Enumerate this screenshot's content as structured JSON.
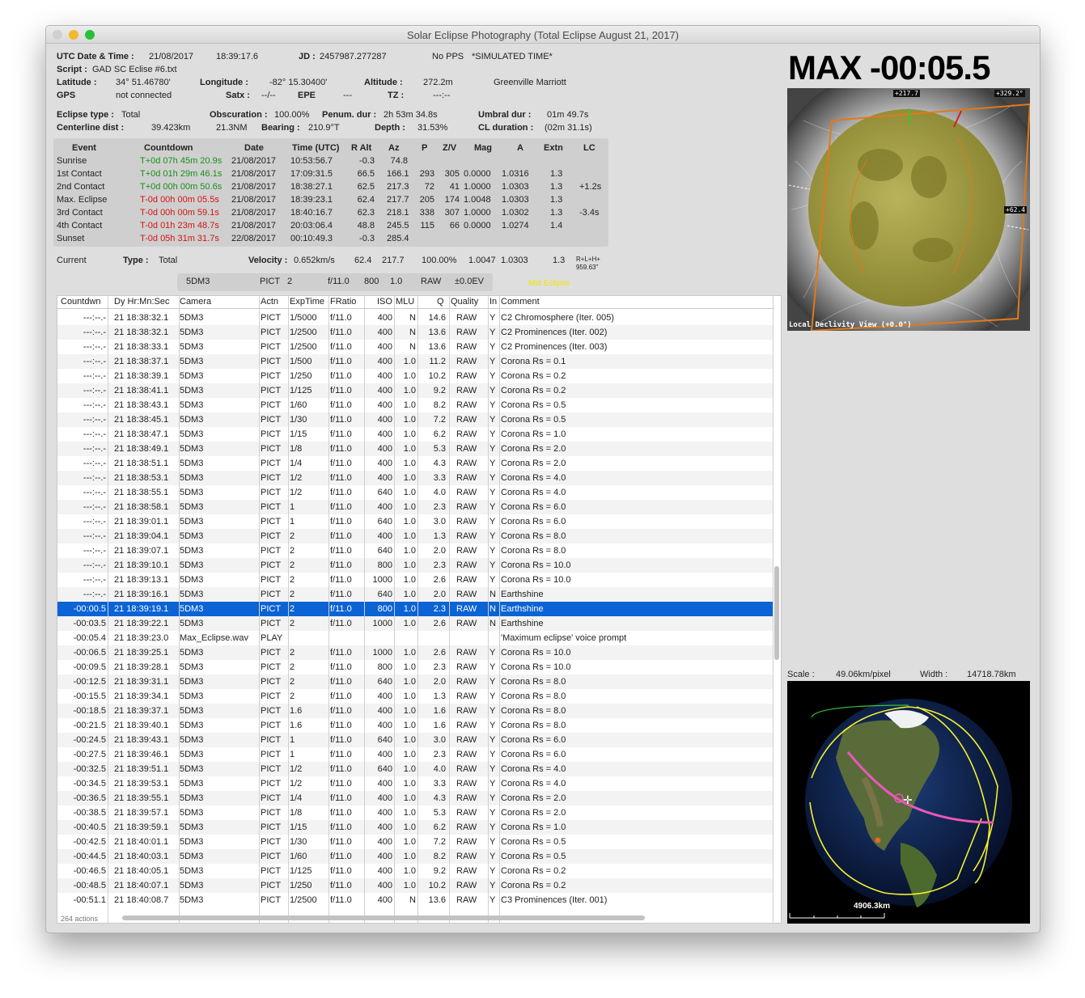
{
  "window": {
    "title": "Solar Eclipse Photography (Total Eclipse August 21, 2017)"
  },
  "info": {
    "utc_label": "UTC Date & Time :",
    "utc_date": "21/08/2017",
    "utc_time": "18:39:17.6",
    "jd_label": "JD :",
    "jd": "2457987.277287",
    "pps": "No PPS",
    "sim": "*SIMULATED TIME*",
    "script_label": "Script :",
    "script": "GAD SC Eclise #6.txt",
    "lat_label": "Latitude :",
    "lat": "34° 51.46780'",
    "lon_label": "Longitude :",
    "lon": "-82° 15.30400'",
    "alt_label": "Altitude :",
    "alt": "272.2m",
    "location": "Greenville Marriott",
    "gps_label": "GPS",
    "gps": "not connected",
    "satx_label": "Satx :",
    "satx": "--/--",
    "epe_label": "EPE",
    "epe": "---",
    "tz_label": "TZ :",
    "tz": "---:--",
    "etype_label": "Eclipse type :",
    "etype": "Total",
    "obs_label": "Obscuration :",
    "obs": "100.00%",
    "pen_label": "Penum. dur :",
    "pen": "2h 53m 34.8s",
    "umb_label": "Umbral dur :",
    "umb": "01m 49.7s",
    "cdist_label": "Centerline dist :",
    "cdist": "39.423km",
    "cnm": "21.3NM",
    "bear_label": "Bearing :",
    "bear": "210.9°T",
    "depth_label": "Depth :",
    "depth": "31.53%",
    "cld_label": "CL duration :",
    "cld": "(02m 31.1s)"
  },
  "events": {
    "headers": [
      "Event",
      "Countdown",
      "Date",
      "Time (UTC)",
      "R Alt",
      "Az",
      "P",
      "Z/V",
      "Mag",
      "A",
      "Extn",
      "LC"
    ],
    "rows": [
      {
        "name": "Sunrise",
        "cd": "T+0d 07h 45m 20.9s",
        "date": "21/08/2017",
        "time": "10:53:56.7",
        "ralt": "-0.3",
        "az": "74.8",
        "p": "",
        "zv": "",
        "mag": "",
        "a": "",
        "extn": "",
        "lc": ""
      },
      {
        "name": "1st Contact",
        "cd": "T+0d 01h 29m 46.1s",
        "date": "21/08/2017",
        "time": "17:09:31.5",
        "ralt": "66.5",
        "az": "166.1",
        "p": "293",
        "zv": "305",
        "mag": "0.0000",
        "a": "1.0316",
        "extn": "1.3",
        "lc": ""
      },
      {
        "name": "2nd Contact",
        "cd": "T+0d 00h 00m 50.6s",
        "date": "21/08/2017",
        "time": "18:38:27.1",
        "ralt": "62.5",
        "az": "217.3",
        "p": "72",
        "zv": "41",
        "mag": "1.0000",
        "a": "1.0303",
        "extn": "1.3",
        "lc": "+1.2s"
      },
      {
        "name": "Max. Eclipse",
        "cd": "T-0d 00h 00m 05.5s",
        "date": "21/08/2017",
        "time": "18:39:23.1",
        "ralt": "62.4",
        "az": "217.7",
        "p": "205",
        "zv": "174",
        "mag": "1.0048",
        "a": "1.0303",
        "extn": "1.3",
        "lc": ""
      },
      {
        "name": "3rd Contact",
        "cd": "T-0d 00h 00m 59.1s",
        "date": "21/08/2017",
        "time": "18:40:16.7",
        "ralt": "62.3",
        "az": "218.1",
        "p": "338",
        "zv": "307",
        "mag": "1.0000",
        "a": "1.0302",
        "extn": "1.3",
        "lc": "-3.4s"
      },
      {
        "name": "4th Contact",
        "cd": "T-0d 01h 23m 48.7s",
        "date": "21/08/2017",
        "time": "20:03:06.4",
        "ralt": "48.8",
        "az": "245.5",
        "p": "115",
        "zv": "66",
        "mag": "0.0000",
        "a": "1.0274",
        "extn": "1.4",
        "lc": ""
      },
      {
        "name": "Sunset",
        "cd": "T-0d 05h 31m 31.7s",
        "date": "22/08/2017",
        "time": "00:10:49.3",
        "ralt": "-0.3",
        "az": "285.4",
        "p": "",
        "zv": "",
        "mag": "",
        "a": "",
        "extn": "",
        "lc": ""
      }
    ],
    "cd_colors": [
      "green",
      "green",
      "green",
      "red",
      "red",
      "red",
      "red"
    ]
  },
  "current": {
    "label": "Current",
    "type_label": "Type :",
    "type": "Total",
    "vel_label": "Velocity :",
    "vel": "0.652km/s",
    "ralt": "62.4",
    "az": "217.7",
    "obs": "100.00%",
    "mag": "1.0047",
    "a": "1.0303",
    "extn": "1.3",
    "lc1": "R+L+H+",
    "lc2": "959.63\""
  },
  "pict": {
    "camera": "5DM3",
    "action": "PICT",
    "count": "2",
    "f": "f/11.0",
    "iso": "800",
    "mlu": "1.0",
    "q": "RAW",
    "ev": "±0.0EV",
    "phase": "Mid Eclipse"
  },
  "actions": {
    "headers": [
      "Countdwn",
      "Dy Hr:Mn:Sec",
      "Camera",
      "Actn",
      "ExpTime",
      "FRatio",
      "ISO",
      "MLU",
      "Q",
      "Quality",
      "In",
      "Comment"
    ],
    "selected": 20,
    "rows": [
      [
        "---:--.-",
        "21 18:38:32.1",
        "5DM3",
        "PICT",
        "1/5000",
        "f/11.0",
        "400",
        "N",
        "14.6",
        "RAW",
        "Y",
        "C2 Chromosphere (Iter. 005)"
      ],
      [
        "---:--.-",
        "21 18:38:32.1",
        "5DM3",
        "PICT",
        "1/2500",
        "f/11.0",
        "400",
        "N",
        "13.6",
        "RAW",
        "Y",
        "C2 Prominences (Iter. 002)"
      ],
      [
        "---:--.-",
        "21 18:38:33.1",
        "5DM3",
        "PICT",
        "1/2500",
        "f/11.0",
        "400",
        "N",
        "13.6",
        "RAW",
        "Y",
        "C2 Prominences (Iter. 003)"
      ],
      [
        "---:--.-",
        "21 18:38:37.1",
        "5DM3",
        "PICT",
        "1/500",
        "f/11.0",
        "400",
        "1.0",
        "11.2",
        "RAW",
        "Y",
        "Corona Rs = 0.1"
      ],
      [
        "---:--.-",
        "21 18:38:39.1",
        "5DM3",
        "PICT",
        "1/250",
        "f/11.0",
        "400",
        "1.0",
        "10.2",
        "RAW",
        "Y",
        "Corona Rs = 0.2"
      ],
      [
        "---:--.-",
        "21 18:38:41.1",
        "5DM3",
        "PICT",
        "1/125",
        "f/11.0",
        "400",
        "1.0",
        "9.2",
        "RAW",
        "Y",
        "Corona Rs = 0.2"
      ],
      [
        "---:--.-",
        "21 18:38:43.1",
        "5DM3",
        "PICT",
        "1/60",
        "f/11.0",
        "400",
        "1.0",
        "8.2",
        "RAW",
        "Y",
        "Corona Rs = 0.5"
      ],
      [
        "---:--.-",
        "21 18:38:45.1",
        "5DM3",
        "PICT",
        "1/30",
        "f/11.0",
        "400",
        "1.0",
        "7.2",
        "RAW",
        "Y",
        "Corona Rs = 0.5"
      ],
      [
        "---:--.-",
        "21 18:38:47.1",
        "5DM3",
        "PICT",
        "1/15",
        "f/11.0",
        "400",
        "1.0",
        "6.2",
        "RAW",
        "Y",
        "Corona Rs = 1.0"
      ],
      [
        "---:--.-",
        "21 18:38:49.1",
        "5DM3",
        "PICT",
        "1/8",
        "f/11.0",
        "400",
        "1.0",
        "5.3",
        "RAW",
        "Y",
        "Corona Rs = 2.0"
      ],
      [
        "---:--.-",
        "21 18:38:51.1",
        "5DM3",
        "PICT",
        "1/4",
        "f/11.0",
        "400",
        "1.0",
        "4.3",
        "RAW",
        "Y",
        "Corona Rs = 2.0"
      ],
      [
        "---:--.-",
        "21 18:38:53.1",
        "5DM3",
        "PICT",
        "1/2",
        "f/11.0",
        "400",
        "1.0",
        "3.3",
        "RAW",
        "Y",
        "Corona Rs = 4.0"
      ],
      [
        "---:--.-",
        "21 18:38:55.1",
        "5DM3",
        "PICT",
        "1/2",
        "f/11.0",
        "640",
        "1.0",
        "4.0",
        "RAW",
        "Y",
        "Corona Rs = 4.0"
      ],
      [
        "---:--.-",
        "21 18:38:58.1",
        "5DM3",
        "PICT",
        "1",
        "f/11.0",
        "400",
        "1.0",
        "2.3",
        "RAW",
        "Y",
        "Corona Rs = 6.0"
      ],
      [
        "---:--.-",
        "21 18:39:01.1",
        "5DM3",
        "PICT",
        "1",
        "f/11.0",
        "640",
        "1.0",
        "3.0",
        "RAW",
        "Y",
        "Corona Rs = 6.0"
      ],
      [
        "---:--.-",
        "21 18:39:04.1",
        "5DM3",
        "PICT",
        "2",
        "f/11.0",
        "400",
        "1.0",
        "1.3",
        "RAW",
        "Y",
        "Corona Rs = 8.0"
      ],
      [
        "---:--.-",
        "21 18:39:07.1",
        "5DM3",
        "PICT",
        "2",
        "f/11.0",
        "640",
        "1.0",
        "2.0",
        "RAW",
        "Y",
        "Corona Rs = 8.0"
      ],
      [
        "---:--.-",
        "21 18:39:10.1",
        "5DM3",
        "PICT",
        "2",
        "f/11.0",
        "800",
        "1.0",
        "2.3",
        "RAW",
        "Y",
        "Corona Rs = 10.0"
      ],
      [
        "---:--.-",
        "21 18:39:13.1",
        "5DM3",
        "PICT",
        "2",
        "f/11.0",
        "1000",
        "1.0",
        "2.6",
        "RAW",
        "Y",
        "Corona Rs = 10.0"
      ],
      [
        "---:--.-",
        "21 18:39:16.1",
        "5DM3",
        "PICT",
        "2",
        "f/11.0",
        "640",
        "1.0",
        "2.0",
        "RAW",
        "N",
        "Earthshine"
      ],
      [
        "-00:00.5",
        "21 18:39:19.1",
        "5DM3",
        "PICT",
        "2",
        "f/11.0",
        "800",
        "1.0",
        "2.3",
        "RAW",
        "N",
        "Earthshine"
      ],
      [
        "-00:03.5",
        "21 18:39:22.1",
        "5DM3",
        "PICT",
        "2",
        "f/11.0",
        "1000",
        "1.0",
        "2.6",
        "RAW",
        "N",
        "Earthshine"
      ],
      [
        "-00:05.4",
        "21 18:39:23.0",
        "Max_Eclipse.wav",
        "PLAY",
        "",
        "",
        "",
        "",
        "",
        "",
        "",
        "'Maximum eclipse' voice prompt"
      ],
      [
        "-00:06.5",
        "21 18:39:25.1",
        "5DM3",
        "PICT",
        "2",
        "f/11.0",
        "1000",
        "1.0",
        "2.6",
        "RAW",
        "Y",
        "Corona Rs = 10.0"
      ],
      [
        "-00:09.5",
        "21 18:39:28.1",
        "5DM3",
        "PICT",
        "2",
        "f/11.0",
        "800",
        "1.0",
        "2.3",
        "RAW",
        "Y",
        "Corona Rs = 10.0"
      ],
      [
        "-00:12.5",
        "21 18:39:31.1",
        "5DM3",
        "PICT",
        "2",
        "f/11.0",
        "640",
        "1.0",
        "2.0",
        "RAW",
        "Y",
        "Corona Rs = 8.0"
      ],
      [
        "-00:15.5",
        "21 18:39:34.1",
        "5DM3",
        "PICT",
        "2",
        "f/11.0",
        "400",
        "1.0",
        "1.3",
        "RAW",
        "Y",
        "Corona Rs = 8.0"
      ],
      [
        "-00:18.5",
        "21 18:39:37.1",
        "5DM3",
        "PICT",
        "1.6",
        "f/11.0",
        "400",
        "1.0",
        "1.6",
        "RAW",
        "Y",
        "Corona Rs = 8.0"
      ],
      [
        "-00:21.5",
        "21 18:39:40.1",
        "5DM3",
        "PICT",
        "1.6",
        "f/11.0",
        "400",
        "1.0",
        "1.6",
        "RAW",
        "Y",
        "Corona Rs = 8.0"
      ],
      [
        "-00:24.5",
        "21 18:39:43.1",
        "5DM3",
        "PICT",
        "1",
        "f/11.0",
        "640",
        "1.0",
        "3.0",
        "RAW",
        "Y",
        "Corona Rs = 6.0"
      ],
      [
        "-00:27.5",
        "21 18:39:46.1",
        "5DM3",
        "PICT",
        "1",
        "f/11.0",
        "400",
        "1.0",
        "2.3",
        "RAW",
        "Y",
        "Corona Rs = 6.0"
      ],
      [
        "-00:32.5",
        "21 18:39:51.1",
        "5DM3",
        "PICT",
        "1/2",
        "f/11.0",
        "640",
        "1.0",
        "4.0",
        "RAW",
        "Y",
        "Corona Rs = 4.0"
      ],
      [
        "-00:34.5",
        "21 18:39:53.1",
        "5DM3",
        "PICT",
        "1/2",
        "f/11.0",
        "400",
        "1.0",
        "3.3",
        "RAW",
        "Y",
        "Corona Rs = 4.0"
      ],
      [
        "-00:36.5",
        "21 18:39:55.1",
        "5DM3",
        "PICT",
        "1/4",
        "f/11.0",
        "400",
        "1.0",
        "4.3",
        "RAW",
        "Y",
        "Corona Rs = 2.0"
      ],
      [
        "-00:38.5",
        "21 18:39:57.1",
        "5DM3",
        "PICT",
        "1/8",
        "f/11.0",
        "400",
        "1.0",
        "5.3",
        "RAW",
        "Y",
        "Corona Rs = 2.0"
      ],
      [
        "-00:40.5",
        "21 18:39:59.1",
        "5DM3",
        "PICT",
        "1/15",
        "f/11.0",
        "400",
        "1.0",
        "6.2",
        "RAW",
        "Y",
        "Corona Rs = 1.0"
      ],
      [
        "-00:42.5",
        "21 18:40:01.1",
        "5DM3",
        "PICT",
        "1/30",
        "f/11.0",
        "400",
        "1.0",
        "7.2",
        "RAW",
        "Y",
        "Corona Rs = 0.5"
      ],
      [
        "-00:44.5",
        "21 18:40:03.1",
        "5DM3",
        "PICT",
        "1/60",
        "f/11.0",
        "400",
        "1.0",
        "8.2",
        "RAW",
        "Y",
        "Corona Rs = 0.5"
      ],
      [
        "-00:46.5",
        "21 18:40:05.1",
        "5DM3",
        "PICT",
        "1/125",
        "f/11.0",
        "400",
        "1.0",
        "9.2",
        "RAW",
        "Y",
        "Corona Rs = 0.2"
      ],
      [
        "-00:48.5",
        "21 18:40:07.1",
        "5DM3",
        "PICT",
        "1/250",
        "f/11.0",
        "400",
        "1.0",
        "10.2",
        "RAW",
        "Y",
        "Corona Rs = 0.2"
      ],
      [
        "-00:51.1",
        "21 18:40:08.7",
        "5DM3",
        "PICT",
        "1/2500",
        "f/11.0",
        "400",
        "N",
        "13.6",
        "RAW",
        "Y",
        "C3 Prominences (Iter. 001)"
      ]
    ],
    "count": "264 actions"
  },
  "max": {
    "label": "MAX -00:05.5"
  },
  "sunview": {
    "caption": "Local Declivity View (+0.0°)",
    "tag1": "+217.7",
    "tag2": "+329.2°",
    "tag3": "+62.4"
  },
  "map": {
    "scale_label": "Scale :",
    "scale": "49.06km/pixel",
    "width_label": "Width :",
    "width": "14718.78km",
    "bar": "4906.3km"
  }
}
